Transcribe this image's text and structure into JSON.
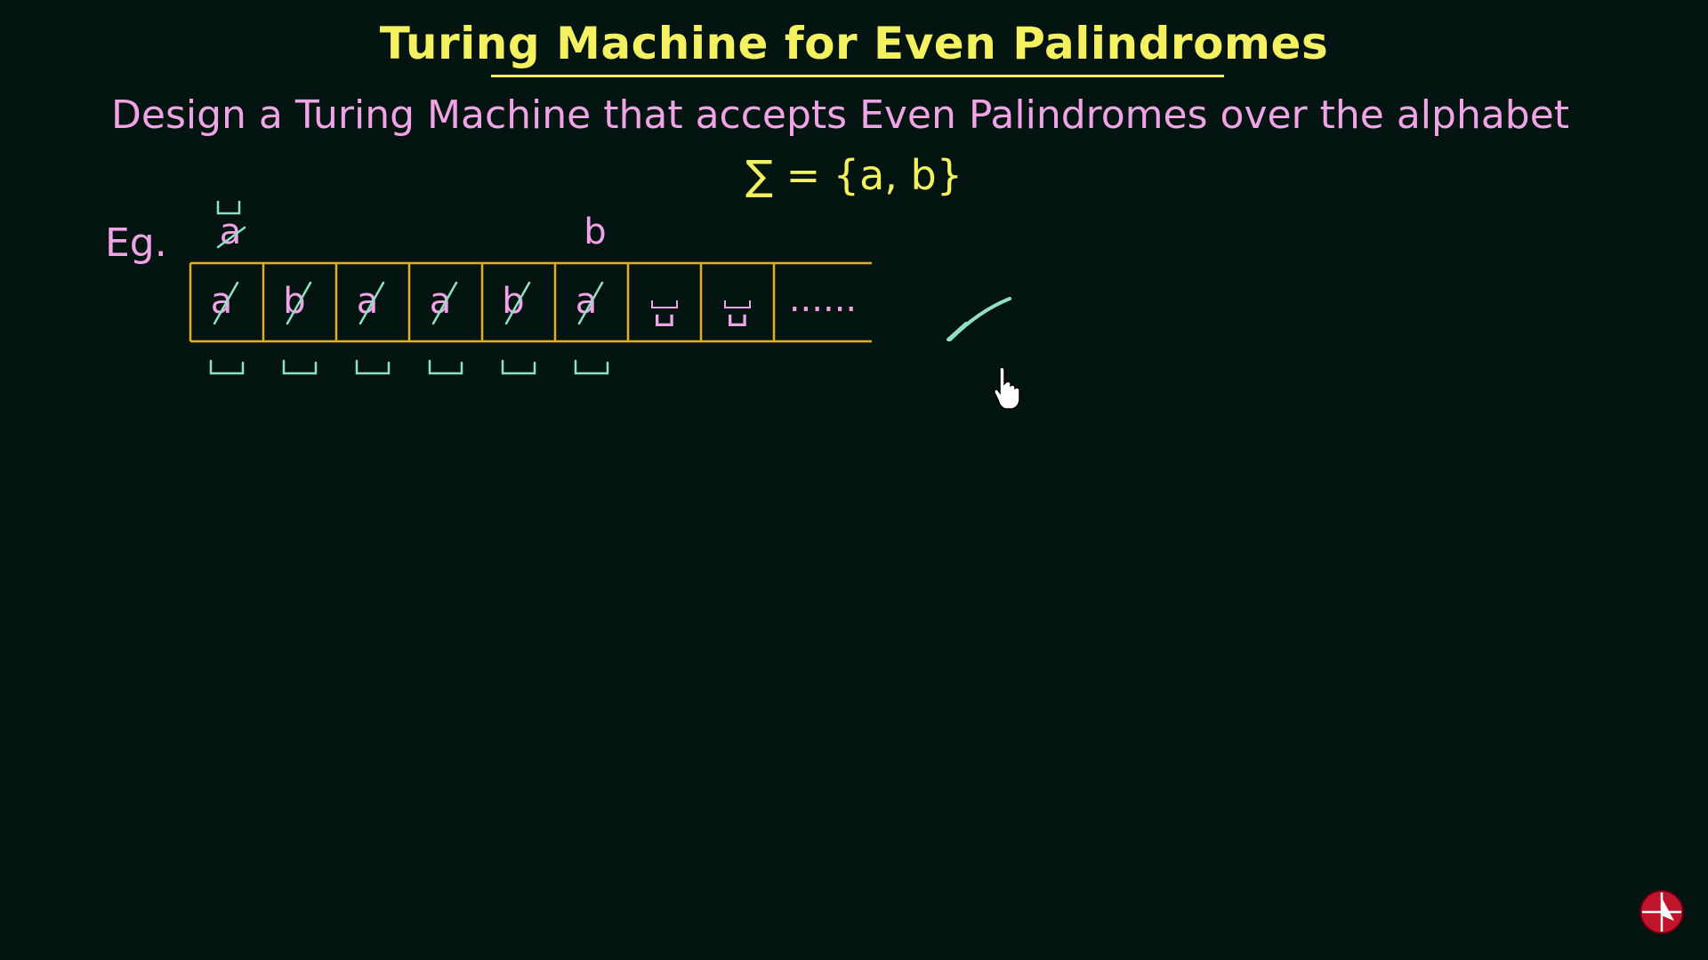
{
  "slide": {
    "title": "Turing Machine for Even Palindromes",
    "problem_text": "Design a Turing Machine that accepts Even Palindromes over the alphabet",
    "alphabet_text": "∑ = {a, b}",
    "example_label": "Eg."
  },
  "tape": {
    "cells": [
      {
        "symbol": "a",
        "crossed": true
      },
      {
        "symbol": "b",
        "crossed": true
      },
      {
        "symbol": "a",
        "crossed": true
      },
      {
        "symbol": "a",
        "crossed": true
      },
      {
        "symbol": "b",
        "crossed": true
      },
      {
        "symbol": "a",
        "crossed": true
      },
      {
        "symbol": "␣",
        "crossed": false
      },
      {
        "symbol": "␣",
        "crossed": false
      },
      {
        "symbol": "......",
        "crossed": false
      }
    ],
    "above_marks": [
      {
        "cell": 0,
        "text": "a",
        "crossed": true,
        "blank_above": true
      },
      {
        "cell": 5,
        "text": "b",
        "crossed": false,
        "blank_above": false
      }
    ],
    "below_blank_cells": [
      0,
      1,
      2,
      3,
      4,
      5
    ]
  },
  "result": {
    "icon": "check-mark-icon"
  },
  "colors": {
    "background": "#041511",
    "title": "#f4f160",
    "text_pink": "#f0a4e6",
    "tape_border": "#e0b020",
    "chalk_green": "#8fe0c4"
  }
}
